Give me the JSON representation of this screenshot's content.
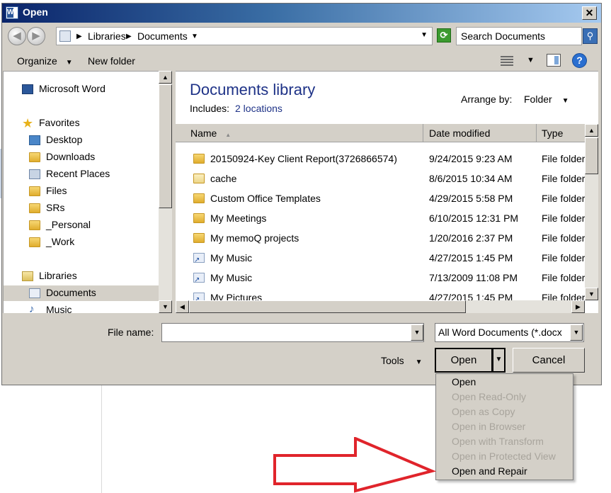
{
  "window": {
    "title": "Open",
    "close_label": "✕"
  },
  "address": {
    "crumbs": [
      "Libraries",
      "Documents"
    ],
    "search_placeholder": "Search Documents"
  },
  "toolbar": {
    "organize_label": "Organize",
    "new_folder_label": "New folder",
    "help_label": "?"
  },
  "nav": {
    "items": [
      {
        "label": "Microsoft Word",
        "icon": "word-icon"
      },
      {
        "label": "Favorites",
        "icon": "star-icon"
      },
      {
        "label": "Desktop",
        "icon": "desktop-icon"
      },
      {
        "label": "Downloads",
        "icon": "folder-icon"
      },
      {
        "label": "Recent Places",
        "icon": "recent-places-icon"
      },
      {
        "label": "Files",
        "icon": "folder-icon"
      },
      {
        "label": "SRs",
        "icon": "folder-icon"
      },
      {
        "label": "_Personal",
        "icon": "folder-icon"
      },
      {
        "label": "_Work",
        "icon": "folder-icon"
      },
      {
        "label": "Libraries",
        "icon": "libraries-icon"
      },
      {
        "label": "Documents",
        "icon": "documents-icon",
        "selected": true
      },
      {
        "label": "Music",
        "icon": "music-icon"
      }
    ]
  },
  "library": {
    "title": "Documents library",
    "includes_label": "Includes:",
    "locations": "2 locations",
    "arrange_label": "Arrange by:",
    "arrange_value": "Folder"
  },
  "columns": {
    "name": "Name",
    "date": "Date modified",
    "type": "Type"
  },
  "files": [
    {
      "name": "20150924-Key Client Report(3726866574)",
      "date": "9/24/2015 9:23 AM",
      "type": "File folder",
      "icon": "folder-icon"
    },
    {
      "name": "cache",
      "date": "8/6/2015 10:34 AM",
      "type": "File folder",
      "icon": "folder-icon"
    },
    {
      "name": "Custom Office Templates",
      "date": "4/29/2015 5:58 PM",
      "type": "File folder",
      "icon": "folder-icon"
    },
    {
      "name": "My Meetings",
      "date": "6/10/2015 12:31 PM",
      "type": "File folder",
      "icon": "folder-icon"
    },
    {
      "name": "My memoQ projects",
      "date": "1/20/2016 2:37 PM",
      "type": "File folder",
      "icon": "folder-icon"
    },
    {
      "name": "My Music",
      "date": "4/27/2015 1:45 PM",
      "type": "File folder",
      "icon": "shortcut-icon"
    },
    {
      "name": "My Music",
      "date": "7/13/2009 11:08 PM",
      "type": "File folder",
      "icon": "shortcut-icon"
    },
    {
      "name": "My Pictures",
      "date": "4/27/2015 1:45 PM",
      "type": "File folder",
      "icon": "shortcut-icon"
    }
  ],
  "bottom": {
    "file_name_label": "File name:",
    "file_name_value": "",
    "filter_value": "All Word Documents (*.docx",
    "tools_label": "Tools",
    "open_label": "Open",
    "cancel_label": "Cancel"
  },
  "open_menu": {
    "items": [
      {
        "label": "Open",
        "enabled": true
      },
      {
        "label": "Open Read-Only",
        "enabled": false
      },
      {
        "label": "Open as Copy",
        "enabled": false
      },
      {
        "label": "Open in Browser",
        "enabled": false
      },
      {
        "label": "Open with Transform",
        "enabled": false
      },
      {
        "label": "Open in Protected View",
        "enabled": false
      },
      {
        "label": "Open and Repair",
        "enabled": true
      }
    ]
  },
  "colors": {
    "annotation_arrow": "#e0242b",
    "title_accent": "#1e3287"
  }
}
